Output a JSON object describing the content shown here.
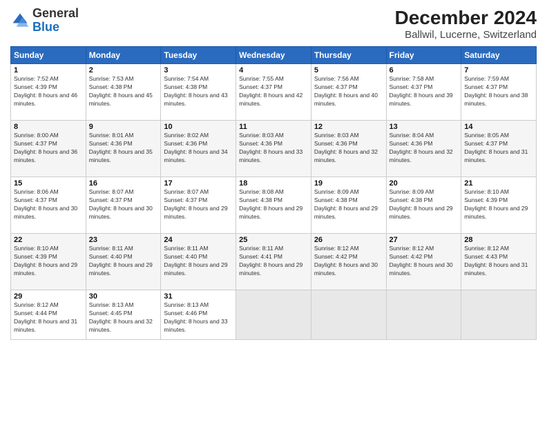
{
  "logo": {
    "general": "General",
    "blue": "Blue"
  },
  "title": "December 2024",
  "subtitle": "Ballwil, Lucerne, Switzerland",
  "days_header": [
    "Sunday",
    "Monday",
    "Tuesday",
    "Wednesday",
    "Thursday",
    "Friday",
    "Saturday"
  ],
  "weeks": [
    [
      {
        "day": "1",
        "rise": "7:52 AM",
        "set": "4:39 PM",
        "hours": "8 hours and 46 minutes."
      },
      {
        "day": "2",
        "rise": "7:53 AM",
        "set": "4:38 PM",
        "hours": "8 hours and 45 minutes."
      },
      {
        "day": "3",
        "rise": "7:54 AM",
        "set": "4:38 PM",
        "hours": "8 hours and 43 minutes."
      },
      {
        "day": "4",
        "rise": "7:55 AM",
        "set": "4:37 PM",
        "hours": "8 hours and 42 minutes."
      },
      {
        "day": "5",
        "rise": "7:56 AM",
        "set": "4:37 PM",
        "hours": "8 hours and 40 minutes."
      },
      {
        "day": "6",
        "rise": "7:58 AM",
        "set": "4:37 PM",
        "hours": "8 hours and 39 minutes."
      },
      {
        "day": "7",
        "rise": "7:59 AM",
        "set": "4:37 PM",
        "hours": "8 hours and 38 minutes."
      }
    ],
    [
      {
        "day": "8",
        "rise": "8:00 AM",
        "set": "4:37 PM",
        "hours": "8 hours and 36 minutes."
      },
      {
        "day": "9",
        "rise": "8:01 AM",
        "set": "4:36 PM",
        "hours": "8 hours and 35 minutes."
      },
      {
        "day": "10",
        "rise": "8:02 AM",
        "set": "4:36 PM",
        "hours": "8 hours and 34 minutes."
      },
      {
        "day": "11",
        "rise": "8:03 AM",
        "set": "4:36 PM",
        "hours": "8 hours and 33 minutes."
      },
      {
        "day": "12",
        "rise": "8:03 AM",
        "set": "4:36 PM",
        "hours": "8 hours and 32 minutes."
      },
      {
        "day": "13",
        "rise": "8:04 AM",
        "set": "4:36 PM",
        "hours": "8 hours and 32 minutes."
      },
      {
        "day": "14",
        "rise": "8:05 AM",
        "set": "4:37 PM",
        "hours": "8 hours and 31 minutes."
      }
    ],
    [
      {
        "day": "15",
        "rise": "8:06 AM",
        "set": "4:37 PM",
        "hours": "8 hours and 30 minutes."
      },
      {
        "day": "16",
        "rise": "8:07 AM",
        "set": "4:37 PM",
        "hours": "8 hours and 30 minutes."
      },
      {
        "day": "17",
        "rise": "8:07 AM",
        "set": "4:37 PM",
        "hours": "8 hours and 29 minutes."
      },
      {
        "day": "18",
        "rise": "8:08 AM",
        "set": "4:38 PM",
        "hours": "8 hours and 29 minutes."
      },
      {
        "day": "19",
        "rise": "8:09 AM",
        "set": "4:38 PM",
        "hours": "8 hours and 29 minutes."
      },
      {
        "day": "20",
        "rise": "8:09 AM",
        "set": "4:38 PM",
        "hours": "8 hours and 29 minutes."
      },
      {
        "day": "21",
        "rise": "8:10 AM",
        "set": "4:39 PM",
        "hours": "8 hours and 29 minutes."
      }
    ],
    [
      {
        "day": "22",
        "rise": "8:10 AM",
        "set": "4:39 PM",
        "hours": "8 hours and 29 minutes."
      },
      {
        "day": "23",
        "rise": "8:11 AM",
        "set": "4:40 PM",
        "hours": "8 hours and 29 minutes."
      },
      {
        "day": "24",
        "rise": "8:11 AM",
        "set": "4:40 PM",
        "hours": "8 hours and 29 minutes."
      },
      {
        "day": "25",
        "rise": "8:11 AM",
        "set": "4:41 PM",
        "hours": "8 hours and 29 minutes."
      },
      {
        "day": "26",
        "rise": "8:12 AM",
        "set": "4:42 PM",
        "hours": "8 hours and 30 minutes."
      },
      {
        "day": "27",
        "rise": "8:12 AM",
        "set": "4:42 PM",
        "hours": "8 hours and 30 minutes."
      },
      {
        "day": "28",
        "rise": "8:12 AM",
        "set": "4:43 PM",
        "hours": "8 hours and 31 minutes."
      }
    ],
    [
      {
        "day": "29",
        "rise": "8:12 AM",
        "set": "4:44 PM",
        "hours": "8 hours and 31 minutes."
      },
      {
        "day": "30",
        "rise": "8:13 AM",
        "set": "4:45 PM",
        "hours": "8 hours and 32 minutes."
      },
      {
        "day": "31",
        "rise": "8:13 AM",
        "set": "4:46 PM",
        "hours": "8 hours and 33 minutes."
      },
      null,
      null,
      null,
      null
    ]
  ],
  "labels": {
    "sunrise": "Sunrise:",
    "sunset": "Sunset:",
    "daylight": "Daylight:"
  }
}
